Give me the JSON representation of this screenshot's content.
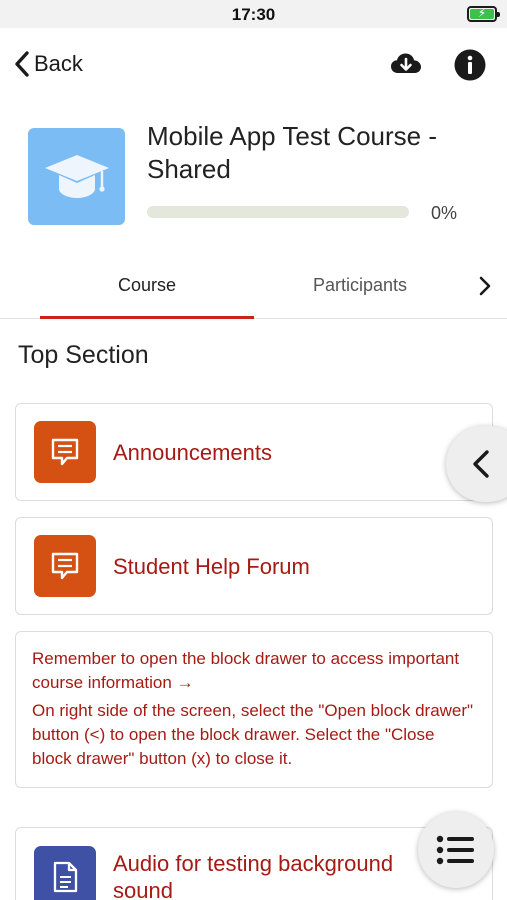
{
  "status_bar": {
    "time": "17:30",
    "battery_level": 1.0
  },
  "nav": {
    "back_label": "Back",
    "download_icon": "cloud-download-icon",
    "info_icon": "info-icon"
  },
  "course": {
    "title": "Mobile App Test Course - Shared",
    "progress": 0,
    "progress_label": "0%",
    "image_icon": "graduation-cap-icon"
  },
  "tabs": [
    {
      "label": "Course",
      "active": true
    },
    {
      "label": "Participants",
      "active": false
    }
  ],
  "section": {
    "title": "Top Section"
  },
  "activities": [
    {
      "name": "Announcements",
      "icon": "forum-icon"
    },
    {
      "name": "Student Help Forum",
      "icon": "forum-icon"
    },
    {
      "name": "Audio for testing background sound",
      "icon": "file-icon"
    }
  ],
  "label": {
    "line1": "Remember to open the block drawer to access important course information →",
    "line2": "On right side of the screen, select the \"Open block drawer\" button (<) to open the block drawer. Select the \"Close block drawer\" button (x) to close it."
  },
  "colors": {
    "accent": "#c8231b",
    "link_text": "#a61a14",
    "forum_icon_bg": "#d45113",
    "resource_icon_bg": "#3f51a5",
    "course_image_bg": "#7cbcf5",
    "battery": "#3cc24c"
  }
}
